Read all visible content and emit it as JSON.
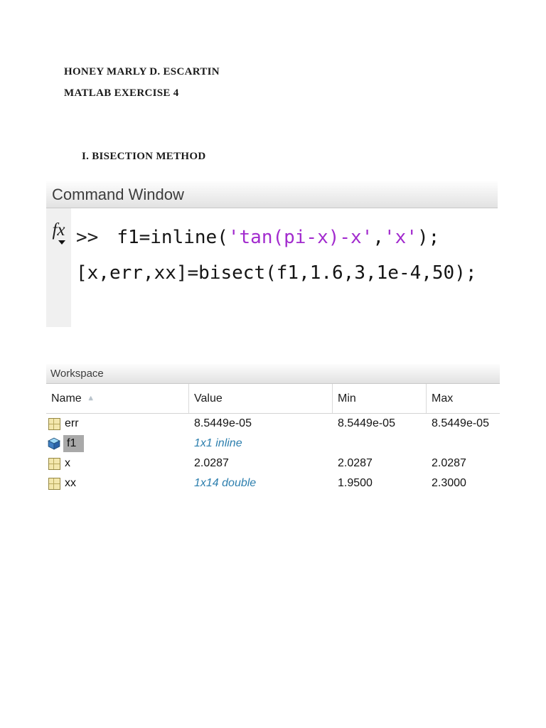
{
  "doc": {
    "student_name": "HONEY MARLY D. ESCARTIN",
    "exercise_title": "MATLAB EXERCISE 4",
    "section_heading": "I. BISECTION METHOD"
  },
  "command_window": {
    "title": "Command Window",
    "fx_label": "fx",
    "prompt": ">>",
    "lines": [
      {
        "segments": [
          {
            "type": "code",
            "text": "f1=inline("
          },
          {
            "type": "string",
            "text": "'tan(pi-x)-x'"
          },
          {
            "type": "code",
            "text": ","
          },
          {
            "type": "string",
            "text": "'x'"
          },
          {
            "type": "code",
            "text": ");"
          }
        ]
      },
      {
        "segments": [
          {
            "type": "code",
            "text": "[x,err,xx]=bisect(f1,1.6,3,1e-4,50);"
          }
        ]
      }
    ],
    "colors": {
      "string_literal": "#a22bce",
      "code_text": "#141414"
    }
  },
  "workspace": {
    "title": "Workspace",
    "columns": [
      "Name",
      "Value",
      "Min",
      "Max"
    ],
    "sort_indicator": "▲",
    "rows": [
      {
        "icon": "matrix-icon",
        "name": "err",
        "value": "8.5449e-05",
        "min": "8.5449e-05",
        "max": "8.5449e-05",
        "value_style": "normal",
        "selected": false
      },
      {
        "icon": "inline-object-icon",
        "name": "f1",
        "value": "1x1 inline",
        "min": "",
        "max": "",
        "value_style": "summary",
        "selected": true
      },
      {
        "icon": "matrix-icon",
        "name": "x",
        "value": "2.0287",
        "min": "2.0287",
        "max": "2.0287",
        "value_style": "normal",
        "selected": false
      },
      {
        "icon": "matrix-icon",
        "name": "xx",
        "value": "1x14 double",
        "min": "1.9500",
        "max": "2.3000",
        "value_style": "summary",
        "selected": false
      }
    ]
  }
}
